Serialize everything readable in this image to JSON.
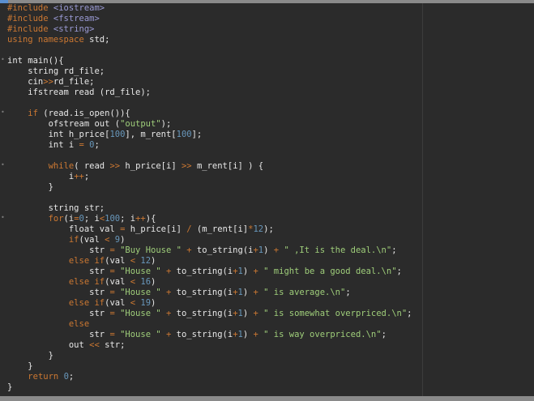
{
  "editor": {
    "theme_colors": {
      "background": "#2b2b2b",
      "keyword": "#cc7832",
      "string": "#9fce7a",
      "number": "#6897bb",
      "text": "#e8e8e8"
    },
    "lines": [
      [
        {
          "t": "#include ",
          "c": "pp"
        },
        {
          "t": "<iostream>",
          "c": "inc"
        }
      ],
      [
        {
          "t": "#include ",
          "c": "pp"
        },
        {
          "t": "<fstream>",
          "c": "inc"
        }
      ],
      [
        {
          "t": "#include ",
          "c": "pp"
        },
        {
          "t": "<string>",
          "c": "inc"
        }
      ],
      [
        {
          "t": "using namespace ",
          "c": "kw"
        },
        {
          "t": "std;",
          "c": "plain"
        }
      ],
      [],
      [
        {
          "t": "int main(){",
          "c": "plain"
        }
      ],
      [
        {
          "t": "    string rd_file;",
          "c": "plain"
        }
      ],
      [
        {
          "t": "    cin",
          "c": "plain"
        },
        {
          "t": ">>",
          "c": "op"
        },
        {
          "t": "rd_file;",
          "c": "plain"
        }
      ],
      [
        {
          "t": "    ifstream read (rd_file);",
          "c": "plain"
        }
      ],
      [],
      [
        {
          "t": "    ",
          "c": "plain"
        },
        {
          "t": "if",
          "c": "kw"
        },
        {
          "t": " (read.is_open()){",
          "c": "plain"
        }
      ],
      [
        {
          "t": "        ofstream out (",
          "c": "plain"
        },
        {
          "t": "\"output\"",
          "c": "str"
        },
        {
          "t": ");",
          "c": "plain"
        }
      ],
      [
        {
          "t": "        int h_price[",
          "c": "plain"
        },
        {
          "t": "100",
          "c": "num"
        },
        {
          "t": "], m_rent[",
          "c": "plain"
        },
        {
          "t": "100",
          "c": "num"
        },
        {
          "t": "];",
          "c": "plain"
        }
      ],
      [
        {
          "t": "        int i ",
          "c": "plain"
        },
        {
          "t": "=",
          "c": "op"
        },
        {
          "t": " ",
          "c": "plain"
        },
        {
          "t": "0",
          "c": "num"
        },
        {
          "t": ";",
          "c": "plain"
        }
      ],
      [],
      [
        {
          "t": "        ",
          "c": "plain"
        },
        {
          "t": "while",
          "c": "kw"
        },
        {
          "t": "( read ",
          "c": "plain"
        },
        {
          "t": ">>",
          "c": "op"
        },
        {
          "t": " h_price[i] ",
          "c": "plain"
        },
        {
          "t": ">>",
          "c": "op"
        },
        {
          "t": " m_rent[i] ) {",
          "c": "plain"
        }
      ],
      [
        {
          "t": "            i",
          "c": "plain"
        },
        {
          "t": "++",
          "c": "op"
        },
        {
          "t": ";",
          "c": "plain"
        }
      ],
      [
        {
          "t": "        }",
          "c": "plain"
        }
      ],
      [],
      [
        {
          "t": "        string str;",
          "c": "plain"
        }
      ],
      [
        {
          "t": "        ",
          "c": "plain"
        },
        {
          "t": "for",
          "c": "kw"
        },
        {
          "t": "(i",
          "c": "plain"
        },
        {
          "t": "=",
          "c": "op"
        },
        {
          "t": "0",
          "c": "num"
        },
        {
          "t": "; i",
          "c": "plain"
        },
        {
          "t": "<",
          "c": "op"
        },
        {
          "t": "100",
          "c": "num"
        },
        {
          "t": "; i",
          "c": "plain"
        },
        {
          "t": "++",
          "c": "op"
        },
        {
          "t": "){",
          "c": "plain"
        }
      ],
      [
        {
          "t": "            float val ",
          "c": "plain"
        },
        {
          "t": "=",
          "c": "op"
        },
        {
          "t": " h_price[i] ",
          "c": "plain"
        },
        {
          "t": "/",
          "c": "op"
        },
        {
          "t": " (m_rent[i]",
          "c": "plain"
        },
        {
          "t": "*",
          "c": "op"
        },
        {
          "t": "12",
          "c": "num"
        },
        {
          "t": ");",
          "c": "plain"
        }
      ],
      [
        {
          "t": "            ",
          "c": "plain"
        },
        {
          "t": "if",
          "c": "kw"
        },
        {
          "t": "(val ",
          "c": "plain"
        },
        {
          "t": "<",
          "c": "op"
        },
        {
          "t": " ",
          "c": "plain"
        },
        {
          "t": "9",
          "c": "num"
        },
        {
          "t": ")",
          "c": "plain"
        }
      ],
      [
        {
          "t": "                str ",
          "c": "plain"
        },
        {
          "t": "=",
          "c": "op"
        },
        {
          "t": " ",
          "c": "plain"
        },
        {
          "t": "\"Buy House \"",
          "c": "str"
        },
        {
          "t": " ",
          "c": "plain"
        },
        {
          "t": "+",
          "c": "op"
        },
        {
          "t": " to_string(i",
          "c": "plain"
        },
        {
          "t": "+",
          "c": "op"
        },
        {
          "t": "1",
          "c": "num"
        },
        {
          "t": ") ",
          "c": "plain"
        },
        {
          "t": "+",
          "c": "op"
        },
        {
          "t": " ",
          "c": "plain"
        },
        {
          "t": "\" ,It is the deal.\\n\"",
          "c": "str"
        },
        {
          "t": ";",
          "c": "plain"
        }
      ],
      [
        {
          "t": "            ",
          "c": "plain"
        },
        {
          "t": "else if",
          "c": "kw"
        },
        {
          "t": "(val ",
          "c": "plain"
        },
        {
          "t": "<",
          "c": "op"
        },
        {
          "t": " ",
          "c": "plain"
        },
        {
          "t": "12",
          "c": "num"
        },
        {
          "t": ")",
          "c": "plain"
        }
      ],
      [
        {
          "t": "                str ",
          "c": "plain"
        },
        {
          "t": "=",
          "c": "op"
        },
        {
          "t": " ",
          "c": "plain"
        },
        {
          "t": "\"House \"",
          "c": "str"
        },
        {
          "t": " ",
          "c": "plain"
        },
        {
          "t": "+",
          "c": "op"
        },
        {
          "t": " to_string(i",
          "c": "plain"
        },
        {
          "t": "+",
          "c": "op"
        },
        {
          "t": "1",
          "c": "num"
        },
        {
          "t": ") ",
          "c": "plain"
        },
        {
          "t": "+",
          "c": "op"
        },
        {
          "t": " ",
          "c": "plain"
        },
        {
          "t": "\" might be a good deal.\\n\"",
          "c": "str"
        },
        {
          "t": ";",
          "c": "plain"
        }
      ],
      [
        {
          "t": "            ",
          "c": "plain"
        },
        {
          "t": "else if",
          "c": "kw"
        },
        {
          "t": "(val ",
          "c": "plain"
        },
        {
          "t": "<",
          "c": "op"
        },
        {
          "t": " ",
          "c": "plain"
        },
        {
          "t": "16",
          "c": "num"
        },
        {
          "t": ")",
          "c": "plain"
        }
      ],
      [
        {
          "t": "                str ",
          "c": "plain"
        },
        {
          "t": "=",
          "c": "op"
        },
        {
          "t": " ",
          "c": "plain"
        },
        {
          "t": "\"House \"",
          "c": "str"
        },
        {
          "t": " ",
          "c": "plain"
        },
        {
          "t": "+",
          "c": "op"
        },
        {
          "t": " to_string(i",
          "c": "plain"
        },
        {
          "t": "+",
          "c": "op"
        },
        {
          "t": "1",
          "c": "num"
        },
        {
          "t": ") ",
          "c": "plain"
        },
        {
          "t": "+",
          "c": "op"
        },
        {
          "t": " ",
          "c": "plain"
        },
        {
          "t": "\" is average.\\n\"",
          "c": "str"
        },
        {
          "t": ";",
          "c": "plain"
        }
      ],
      [
        {
          "t": "            ",
          "c": "plain"
        },
        {
          "t": "else if",
          "c": "kw"
        },
        {
          "t": "(val ",
          "c": "plain"
        },
        {
          "t": "<",
          "c": "op"
        },
        {
          "t": " ",
          "c": "plain"
        },
        {
          "t": "19",
          "c": "num"
        },
        {
          "t": ")",
          "c": "plain"
        }
      ],
      [
        {
          "t": "                str ",
          "c": "plain"
        },
        {
          "t": "=",
          "c": "op"
        },
        {
          "t": " ",
          "c": "plain"
        },
        {
          "t": "\"House \"",
          "c": "str"
        },
        {
          "t": " ",
          "c": "plain"
        },
        {
          "t": "+",
          "c": "op"
        },
        {
          "t": " to_string(i",
          "c": "plain"
        },
        {
          "t": "+",
          "c": "op"
        },
        {
          "t": "1",
          "c": "num"
        },
        {
          "t": ") ",
          "c": "plain"
        },
        {
          "t": "+",
          "c": "op"
        },
        {
          "t": " ",
          "c": "plain"
        },
        {
          "t": "\" is somewhat overpriced.\\n\"",
          "c": "str"
        },
        {
          "t": ";",
          "c": "plain"
        }
      ],
      [
        {
          "t": "            ",
          "c": "plain"
        },
        {
          "t": "else",
          "c": "kw"
        }
      ],
      [
        {
          "t": "                str ",
          "c": "plain"
        },
        {
          "t": "=",
          "c": "op"
        },
        {
          "t": " ",
          "c": "plain"
        },
        {
          "t": "\"House \"",
          "c": "str"
        },
        {
          "t": " ",
          "c": "plain"
        },
        {
          "t": "+",
          "c": "op"
        },
        {
          "t": " to_string(i",
          "c": "plain"
        },
        {
          "t": "+",
          "c": "op"
        },
        {
          "t": "1",
          "c": "num"
        },
        {
          "t": ") ",
          "c": "plain"
        },
        {
          "t": "+",
          "c": "op"
        },
        {
          "t": " ",
          "c": "plain"
        },
        {
          "t": "\" is way overpriced.\\n\"",
          "c": "str"
        },
        {
          "t": ";",
          "c": "plain"
        }
      ],
      [
        {
          "t": "            out ",
          "c": "plain"
        },
        {
          "t": "<<",
          "c": "op"
        },
        {
          "t": " str;",
          "c": "plain"
        }
      ],
      [
        {
          "t": "        }",
          "c": "plain"
        }
      ],
      [
        {
          "t": "    }",
          "c": "plain"
        }
      ],
      [
        {
          "t": "    ",
          "c": "plain"
        },
        {
          "t": "return",
          "c": "kw"
        },
        {
          "t": " ",
          "c": "plain"
        },
        {
          "t": "0",
          "c": "num"
        },
        {
          "t": ";",
          "c": "plain"
        }
      ],
      [
        {
          "t": "}",
          "c": "plain"
        }
      ]
    ]
  }
}
